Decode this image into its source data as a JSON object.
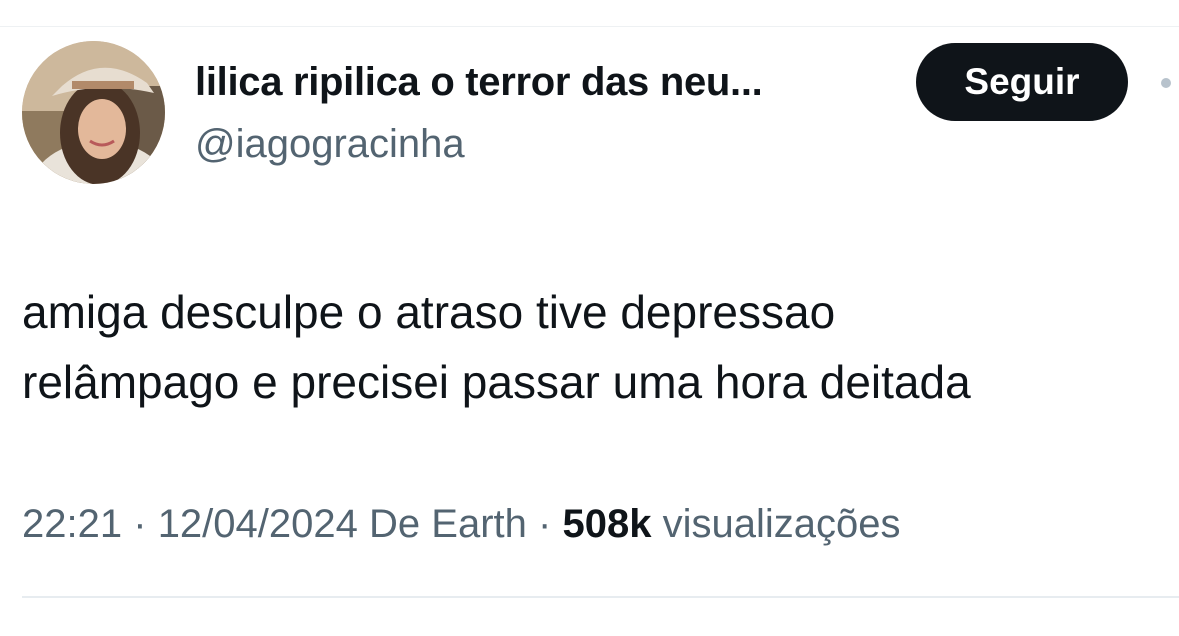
{
  "tweet": {
    "author": {
      "display_name": "lilica ripilica o terror das neu...",
      "handle": "@iagogracinha",
      "avatar_icon": "user-avatar-photo"
    },
    "follow_button_label": "Seguir",
    "more_icon": "more-dot-icon",
    "text_lines": [
      "amiga desculpe o atraso tive depressao",
      "relâmpago e precisei passar uma hora deitada"
    ],
    "meta": {
      "time": "22:21",
      "separator": "·",
      "date": "12/04/2024",
      "source": "De Earth",
      "views_count": "508k",
      "views_label": "visualizações"
    }
  },
  "colors": {
    "text_primary": "#0f1419",
    "text_secondary": "#536471",
    "button_bg": "#0f1419",
    "button_text": "#ffffff",
    "divider": "#e7ecf0"
  }
}
